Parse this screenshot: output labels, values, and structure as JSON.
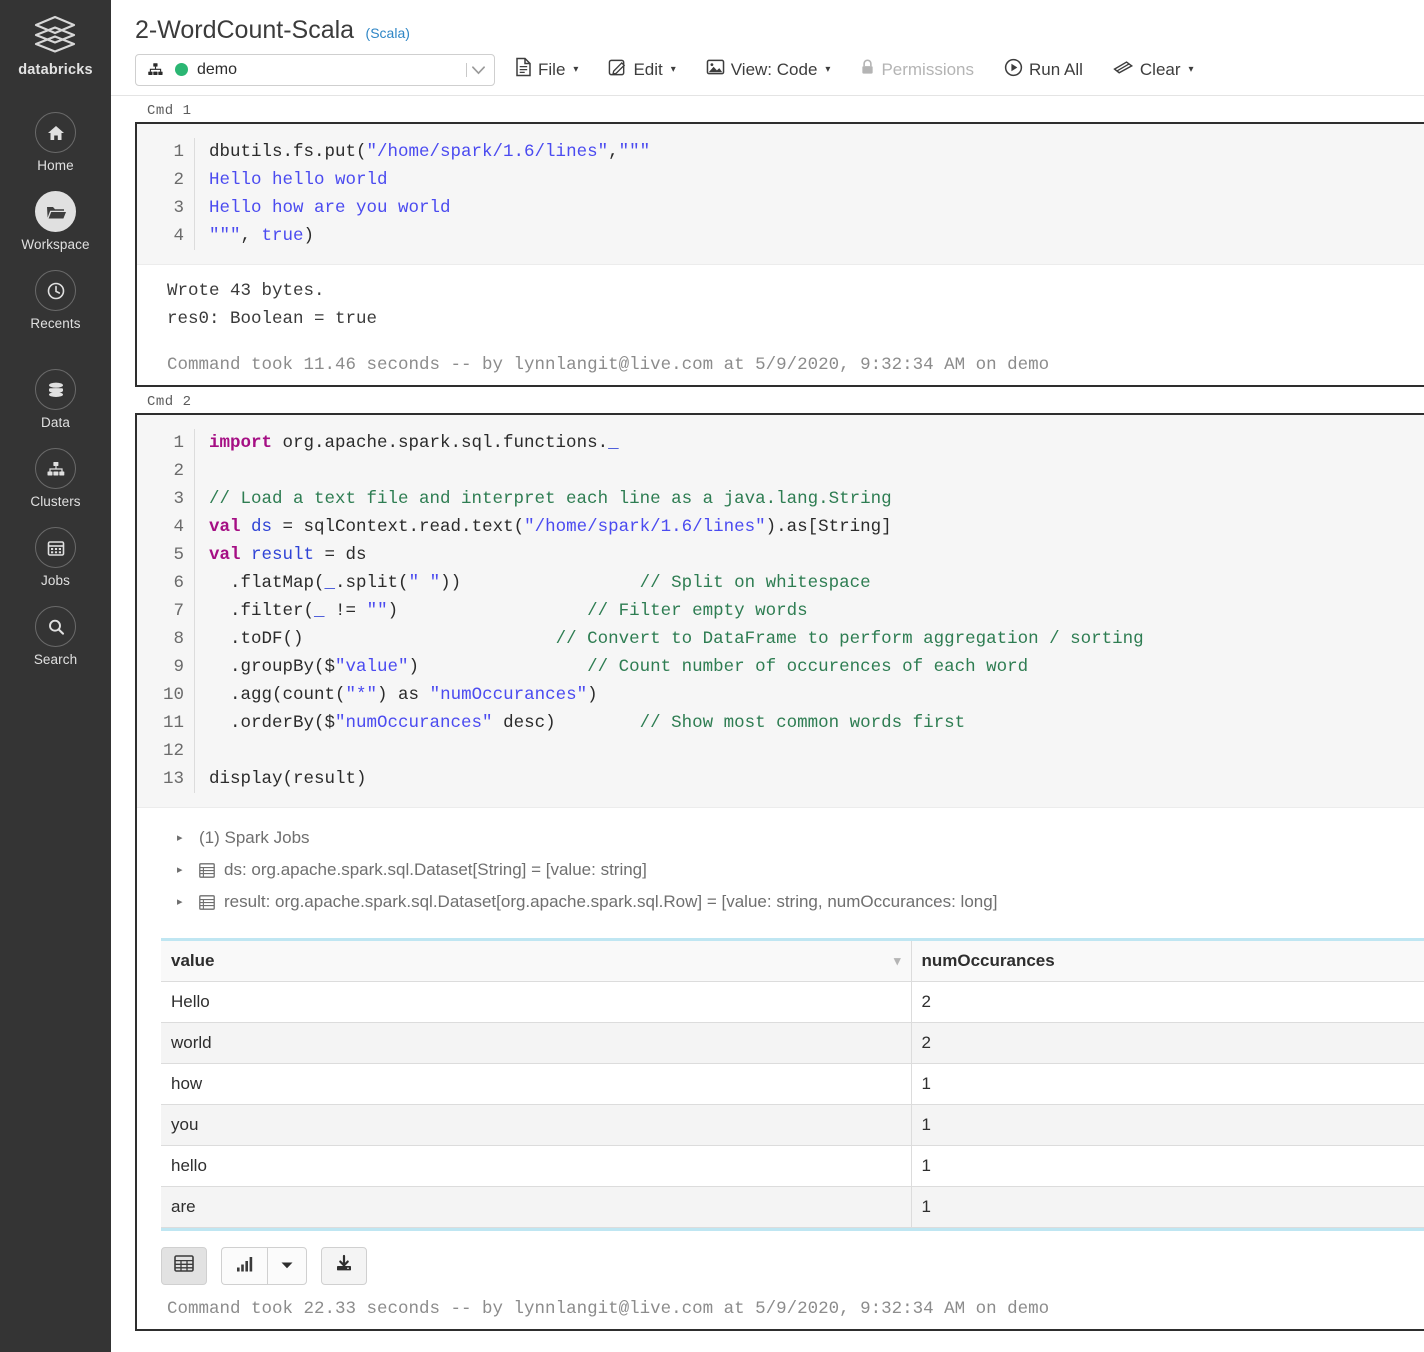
{
  "sidebar": {
    "brand": "databricks",
    "items": [
      {
        "label": "Home",
        "icon": "home-icon",
        "active": false
      },
      {
        "label": "Workspace",
        "icon": "folder-icon",
        "active": true
      },
      {
        "label": "Recents",
        "icon": "clock-icon",
        "active": false
      },
      {
        "label": "Data",
        "icon": "database-icon",
        "active": false
      },
      {
        "label": "Clusters",
        "icon": "cluster-icon",
        "active": false
      },
      {
        "label": "Jobs",
        "icon": "calendar-icon",
        "active": false
      },
      {
        "label": "Search",
        "icon": "search-icon",
        "active": false
      }
    ]
  },
  "notebook": {
    "title": "2-WordCount-Scala",
    "language": "(Scala)"
  },
  "toolbar": {
    "cluster": {
      "name": "demo",
      "status_color": "#2bb673",
      "icon": "cluster-icon"
    },
    "file": "File",
    "edit": "Edit",
    "view": "View: Code",
    "permissions": "Permissions",
    "run_all": "Run All",
    "clear": "Clear",
    "caret": "▾"
  },
  "cells": [
    {
      "label": "Cmd 1",
      "lines": [
        {
          "n": "1",
          "tokens": [
            {
              "t": "dbutils.fs.put(",
              "c": "tok-plain"
            },
            {
              "t": "\"/home/spark/1.6/lines\"",
              "c": "tok-str"
            },
            {
              "t": ",",
              "c": "tok-plain"
            },
            {
              "t": "\"\"\"",
              "c": "tok-str"
            }
          ]
        },
        {
          "n": "2",
          "tokens": [
            {
              "t": "Hello hello world",
              "c": "tok-str"
            }
          ]
        },
        {
          "n": "3",
          "tokens": [
            {
              "t": "Hello how are you world",
              "c": "tok-str"
            }
          ]
        },
        {
          "n": "4",
          "tokens": [
            {
              "t": "\"\"\"",
              "c": "tok-str"
            },
            {
              "t": ", ",
              "c": "tok-plain"
            },
            {
              "t": "true",
              "c": "tok-str"
            },
            {
              "t": ")",
              "c": "tok-plain"
            }
          ]
        }
      ],
      "output_lines": [
        "Wrote 43 bytes.",
        "res0: Boolean = true"
      ],
      "footer": "Command took 11.46 seconds -- by lynnlangit@live.com at 5/9/2020, 9:32:34 AM on demo"
    },
    {
      "label": "Cmd 2",
      "lines": [
        {
          "n": "1",
          "tokens": [
            {
              "t": "import ",
              "c": "tok-kw"
            },
            {
              "t": "org.apache.spark.sql.functions.",
              "c": "tok-plain"
            },
            {
              "t": "_",
              "c": "tok-var"
            }
          ]
        },
        {
          "n": "2",
          "tokens": [
            {
              "t": "",
              "c": "tok-plain"
            }
          ]
        },
        {
          "n": "3",
          "tokens": [
            {
              "t": "// Load a text file and interpret each line as a java.lang.String",
              "c": "tok-cmt"
            }
          ]
        },
        {
          "n": "4",
          "tokens": [
            {
              "t": "val ",
              "c": "tok-kw"
            },
            {
              "t": "ds",
              "c": "tok-var"
            },
            {
              "t": " = sqlContext.read.text(",
              "c": "tok-plain"
            },
            {
              "t": "\"/home/spark/1.6/lines\"",
              "c": "tok-str"
            },
            {
              "t": ").",
              "c": "tok-plain"
            },
            {
              "t": "as",
              "c": "tok-plain"
            },
            {
              "t": "[String]",
              "c": "tok-plain"
            }
          ]
        },
        {
          "n": "5",
          "tokens": [
            {
              "t": "val ",
              "c": "tok-kw"
            },
            {
              "t": "result",
              "c": "tok-var"
            },
            {
              "t": " = ds",
              "c": "tok-plain"
            }
          ]
        },
        {
          "n": "6",
          "tokens": [
            {
              "t": "  .flatMap(",
              "c": "tok-plain"
            },
            {
              "t": "_",
              "c": "tok-var"
            },
            {
              "t": ".split(",
              "c": "tok-plain"
            },
            {
              "t": "\" \"",
              "c": "tok-str"
            },
            {
              "t": "))                 ",
              "c": "tok-plain"
            },
            {
              "t": "// Split on whitespace",
              "c": "tok-cmt"
            }
          ]
        },
        {
          "n": "7",
          "tokens": [
            {
              "t": "  .filter(",
              "c": "tok-plain"
            },
            {
              "t": "_",
              "c": "tok-var"
            },
            {
              "t": " != ",
              "c": "tok-plain"
            },
            {
              "t": "\"\"",
              "c": "tok-str"
            },
            {
              "t": ")                  ",
              "c": "tok-plain"
            },
            {
              "t": "// Filter empty words",
              "c": "tok-cmt"
            }
          ]
        },
        {
          "n": "8",
          "tokens": [
            {
              "t": "  .toDF()                        ",
              "c": "tok-plain"
            },
            {
              "t": "// Convert to DataFrame to perform aggregation / sorting",
              "c": "tok-cmt"
            }
          ]
        },
        {
          "n": "9",
          "tokens": [
            {
              "t": "  .groupBy($",
              "c": "tok-plain"
            },
            {
              "t": "\"value\"",
              "c": "tok-str"
            },
            {
              "t": ")                ",
              "c": "tok-plain"
            },
            {
              "t": "// Count number of occurences of each word",
              "c": "tok-cmt"
            }
          ]
        },
        {
          "n": "10",
          "tokens": [
            {
              "t": "  .agg(count(",
              "c": "tok-plain"
            },
            {
              "t": "\"*\"",
              "c": "tok-str"
            },
            {
              "t": ") as ",
              "c": "tok-plain"
            },
            {
              "t": "\"numOccurances\"",
              "c": "tok-str"
            },
            {
              "t": ")",
              "c": "tok-plain"
            }
          ]
        },
        {
          "n": "11",
          "tokens": [
            {
              "t": "  .orderBy($",
              "c": "tok-plain"
            },
            {
              "t": "\"numOccurances\"",
              "c": "tok-str"
            },
            {
              "t": " desc)        ",
              "c": "tok-plain"
            },
            {
              "t": "// Show most common words first",
              "c": "tok-cmt"
            }
          ]
        },
        {
          "n": "12",
          "tokens": [
            {
              "t": "",
              "c": "tok-plain"
            }
          ]
        },
        {
          "n": "13",
          "tokens": [
            {
              "t": "display(result)",
              "c": "tok-plain"
            }
          ]
        }
      ],
      "jobs": [
        {
          "arrow": "▸",
          "icon": null,
          "text": "(1) Spark Jobs"
        },
        {
          "arrow": "▸",
          "icon": "table-icon",
          "text": "ds:  org.apache.spark.sql.Dataset[String] = [value: string]"
        },
        {
          "arrow": "▸",
          "icon": "table-icon",
          "text": "result:  org.apache.spark.sql.Dataset[org.apache.spark.sql.Row] = [value: string, numOccurances: long]"
        }
      ],
      "footer": "Command took 22.33 seconds -- by lynnlangit@live.com at 5/9/2020, 9:32:34 AM on demo"
    }
  ],
  "results_table": {
    "columns": [
      "value",
      "numOccurances"
    ],
    "sort_indicator": "▾",
    "rows": [
      [
        "Hello",
        "2"
      ],
      [
        "world",
        "2"
      ],
      [
        "how",
        "1"
      ],
      [
        "you",
        "1"
      ],
      [
        "hello",
        "1"
      ],
      [
        "are",
        "1"
      ]
    ]
  },
  "viz_toolbar": {
    "table_button": "table-icon",
    "chart_button": "bar-chart-icon",
    "chart_dropdown": "▾",
    "download_button": "download-icon"
  }
}
